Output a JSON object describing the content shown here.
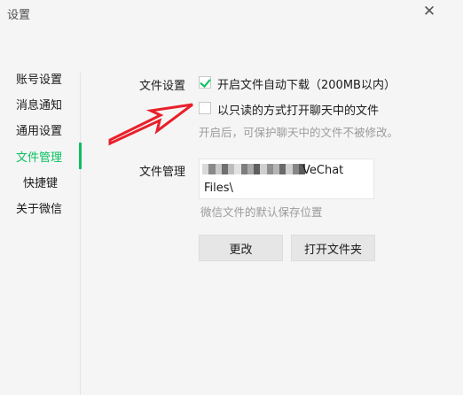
{
  "window": {
    "title": "设置",
    "close_glyph": "✕"
  },
  "sidebar": {
    "items": [
      {
        "label": "账号设置"
      },
      {
        "label": "消息通知"
      },
      {
        "label": "通用设置"
      },
      {
        "label": "文件管理",
        "active": true
      },
      {
        "label": "快捷键"
      },
      {
        "label": "关于微信"
      }
    ]
  },
  "file_settings": {
    "label": "文件设置",
    "auto_download": {
      "text": "开启文件自动下载（200MB以内）",
      "checked": true
    },
    "readonly_open": {
      "text": "以只读的方式打开聊天中的文件",
      "checked": false
    },
    "readonly_hint": "开启后，可保护聊天中的文件不被修改。"
  },
  "file_management": {
    "label": "文件管理",
    "path_visible_part": "VeChat",
    "path_line2": "Files\\",
    "path_hint": "微信文件的默认保存位置"
  },
  "buttons": {
    "change": "更改",
    "open_folder": "打开文件夹"
  },
  "colors": {
    "accent": "#07c160",
    "annotation_arrow": "#e8202a"
  }
}
